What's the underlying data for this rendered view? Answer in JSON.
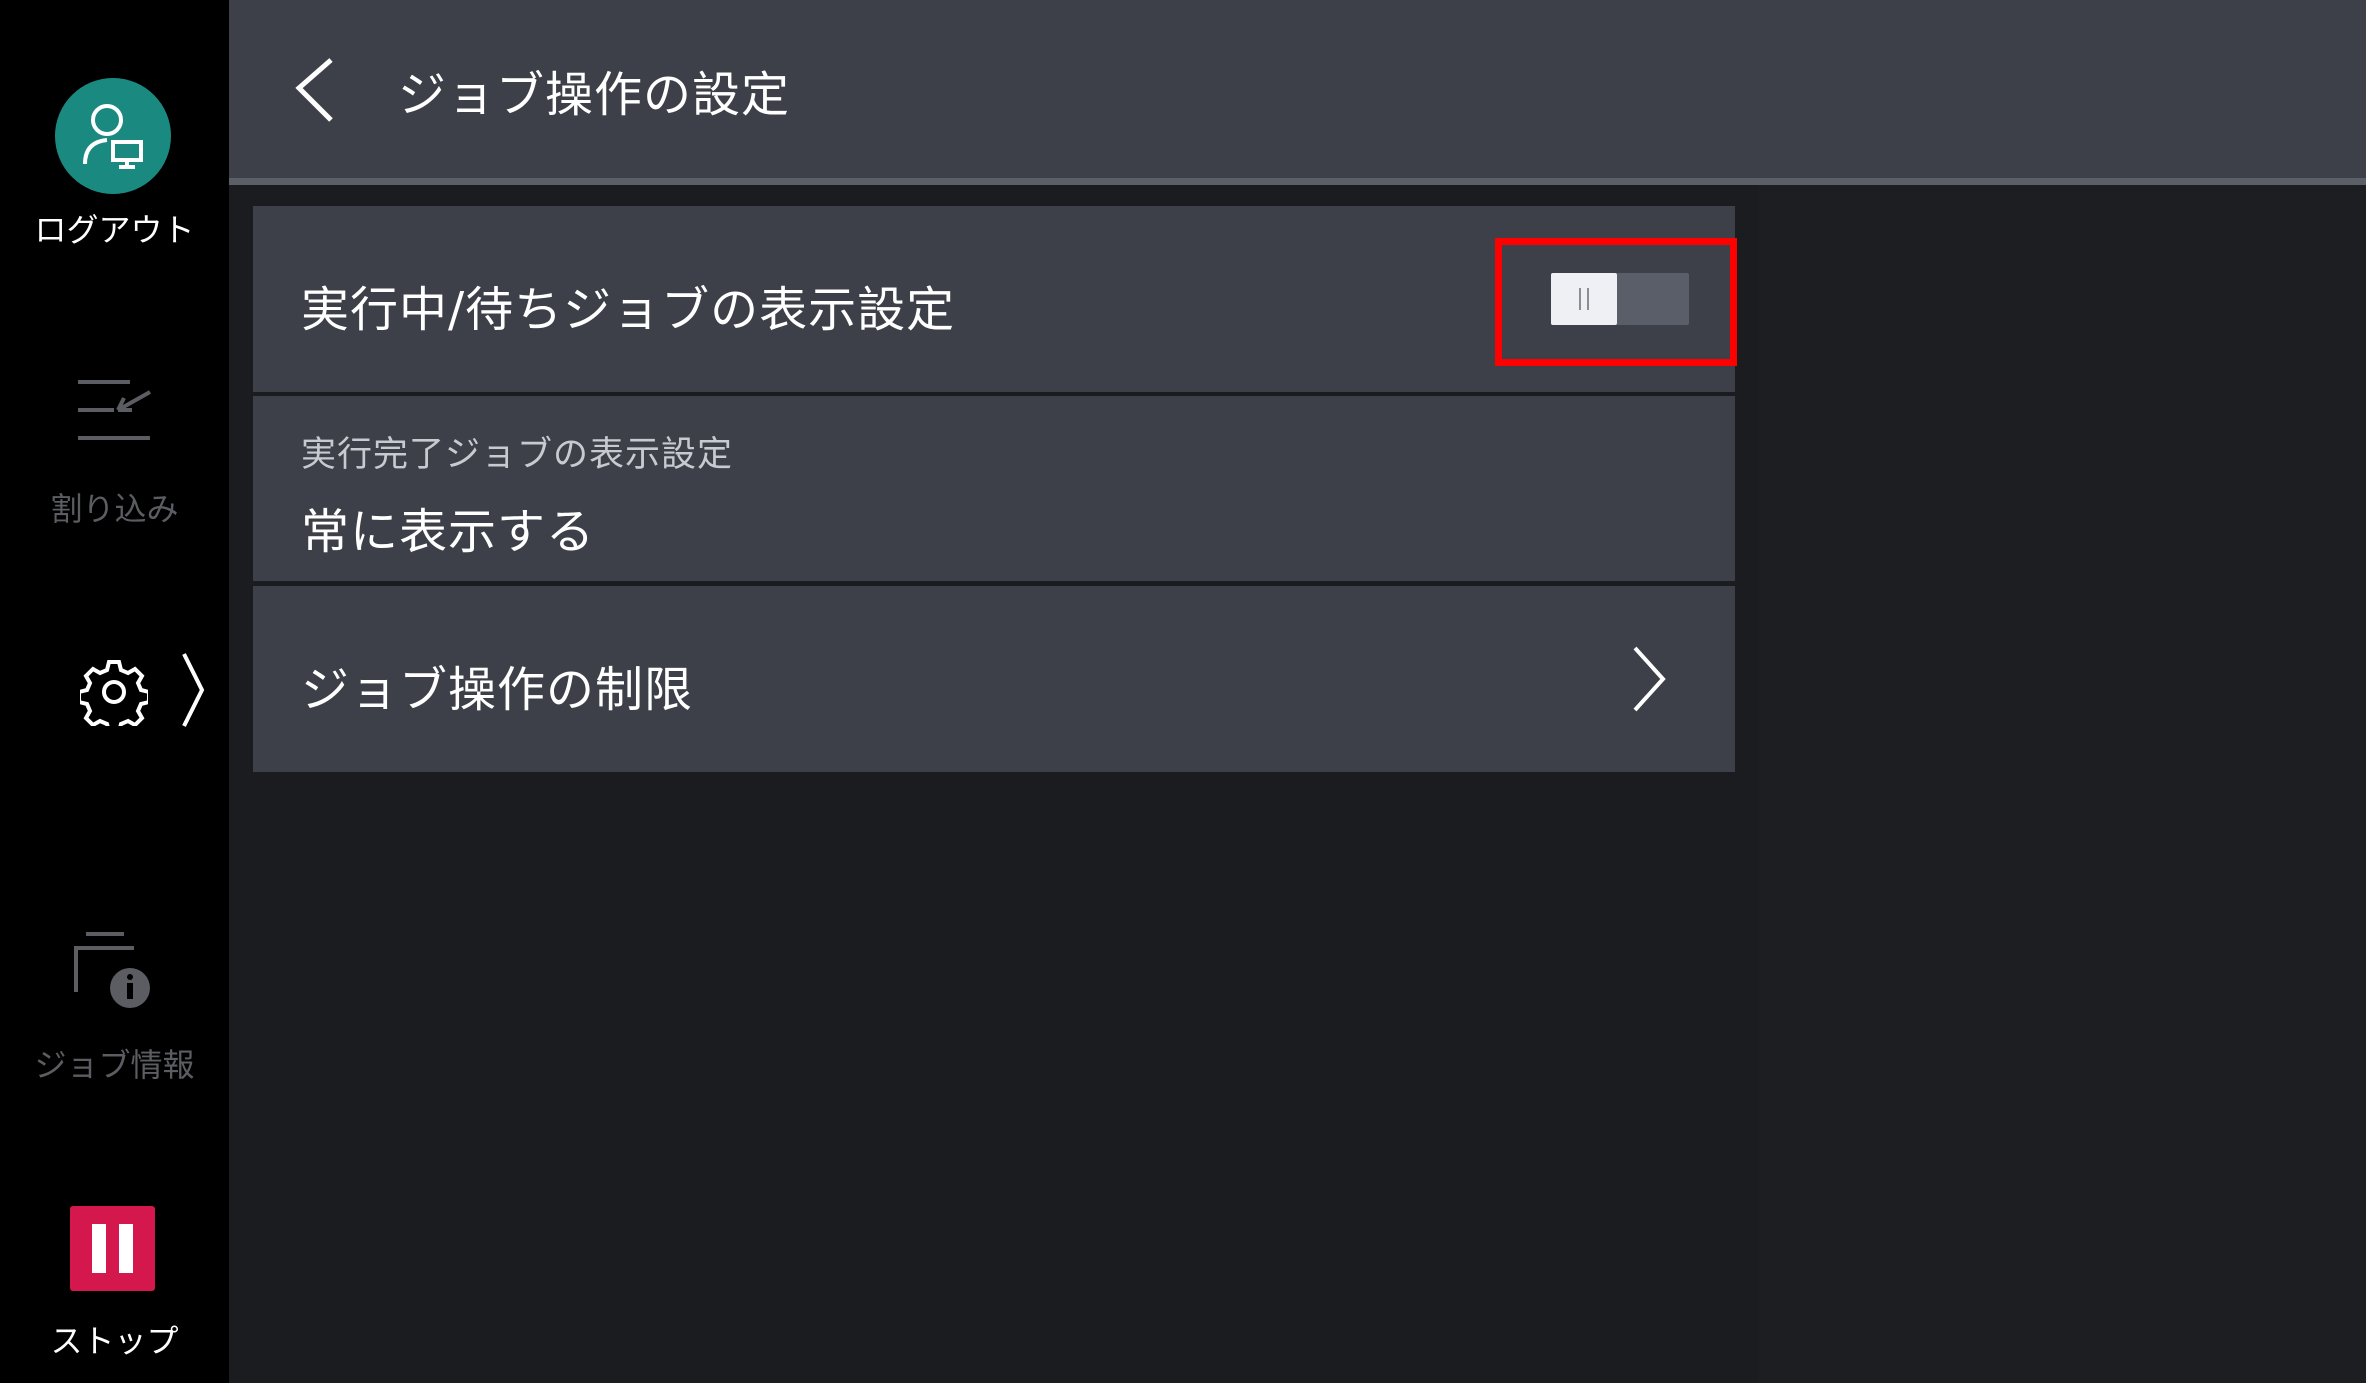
{
  "sidebar": {
    "logout_label": "ログアウト",
    "interrupt_label": "割り込み",
    "job_info_label": "ジョブ情報",
    "stop_label": "ストップ"
  },
  "header": {
    "title": "ジョブ操作の設定"
  },
  "settings": {
    "rows": [
      {
        "title": "実行中/待ちジョブの表示設定",
        "toggle_state": "off"
      },
      {
        "subtitle": "実行完了ジョブの表示設定",
        "value": "常に表示する"
      },
      {
        "title": "ジョブ操作の制限"
      }
    ]
  },
  "colors": {
    "accent_teal": "#1a8a80",
    "stop_red": "#d4174c",
    "highlight_red": "#ff0000",
    "row_bg": "#3d4048"
  }
}
